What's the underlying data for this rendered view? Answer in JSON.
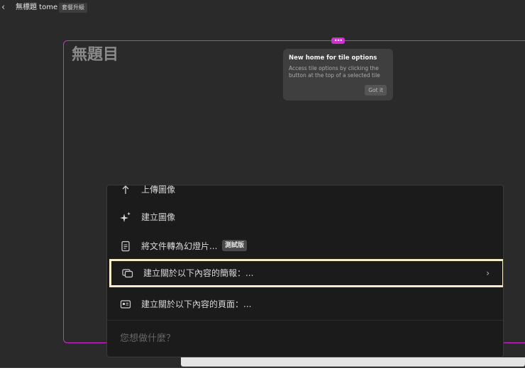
{
  "topbar": {
    "back_icon": "chevron-left-icon",
    "title": "無標題 tome",
    "upgrade_badge": "套餐升級"
  },
  "tile": {
    "heading": "無題目",
    "handle_icon": "more-dots-icon",
    "accent_color": "#d32ed3"
  },
  "tooltip": {
    "title": "New home for tile options",
    "body": "Access tile options by clicking the button at the top of a selected tile",
    "button": "Got it"
  },
  "menu": {
    "items": [
      {
        "label": "上傳圖像",
        "icon": "upload-icon"
      },
      {
        "label": "建立圖像",
        "icon": "sparkle-icon"
      },
      {
        "label": "將文件轉為幻燈片...",
        "icon": "document-icon",
        "badge": "測試版"
      },
      {
        "label": "建立關於以下內容的簡報：...",
        "icon": "slides-icon",
        "selected": true
      },
      {
        "label": "建立關於以下內容的頁面：...",
        "icon": "page-card-icon"
      }
    ],
    "prompt_placeholder": "您想做什麼？",
    "highlight_color": "#f6edc7"
  }
}
